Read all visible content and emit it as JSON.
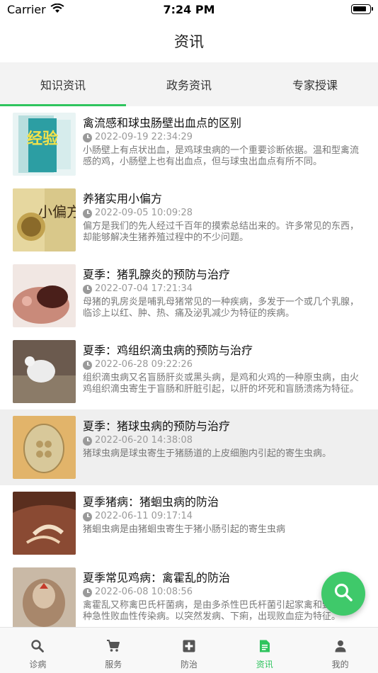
{
  "status_bar": {
    "carrier": "Carrier",
    "time": "7:24 PM"
  },
  "header": {
    "title": "资讯"
  },
  "tabs": [
    {
      "label": "知识资讯",
      "active": true
    },
    {
      "label": "政务资讯",
      "active": false
    },
    {
      "label": "专家授课",
      "active": false
    }
  ],
  "articles": [
    {
      "title": "禽流感和球虫肠壁出血点的区别",
      "date": "2022-09-19 22:34:29",
      "summary": "小肠壁上有点状出血，是鸡球虫病的一个重要诊断依据。温和型禽流感的鸡，小肠壁上也有出血点，但与球虫出血点有所不同。",
      "thumb_text": "经验"
    },
    {
      "title": "养猪实用小偏方",
      "date": "2022-09-05 10:09:28",
      "summary": "偏方是我们的先人经过千百年的摸索总结出来的。许多常见的东西，却能够解决生猪养殖过程中的不少问题。",
      "thumb_text": "小偏方"
    },
    {
      "title": "夏季：猪乳腺炎的预防与治疗",
      "date": "2022-07-04 17:21:34",
      "summary": "母猪的乳房炎是哺乳母猪常见的一种疾病，多发于一个或几个乳腺，临诊上以红、肿、热、痛及泌乳减少为特征的疾病。"
    },
    {
      "title": "夏季：鸡组织滴虫病的预防与治疗",
      "date": "2022-06-28 09:22:26",
      "summary": "组织滴虫病又名盲肠肝炎或黑头病，是鸡和火鸡的一种原虫病，由火鸡组织滴虫寄生于盲肠和肝脏引起，以肝的坏死和盲肠溃疡为特征。"
    },
    {
      "title": "夏季：猪球虫病的预防与治疗",
      "date": "2022-06-20 14:38:08",
      "summary": "猪球虫病是球虫寄生于猪肠道的上皮细胞内引起的寄生虫病。"
    },
    {
      "title": "夏季猪病：猪蛔虫病的防治",
      "date": "2022-06-11 09:17:14",
      "summary": "猪蛔虫病是由猪蛔虫寄生于猪小肠引起的寄生虫病"
    },
    {
      "title": "夏季常见鸡病：禽霍乱的防治",
      "date": "2022-06-08 10:08:56",
      "summary": "禽霍乱又称禽巴氏杆菌病，是由多杀性巴氏杆菌引起家禽和野禽的一种急性败血性传染病。以突然发病、下痢，出现败血症为特征。"
    }
  ],
  "bottom_tabs": [
    {
      "label": "诊病",
      "icon": "search-icon",
      "active": false
    },
    {
      "label": "服务",
      "icon": "cart-icon",
      "active": false
    },
    {
      "label": "防治",
      "icon": "medical-plus-icon",
      "active": false
    },
    {
      "label": "资讯",
      "icon": "news-icon",
      "active": true
    },
    {
      "label": "我的",
      "icon": "person-icon",
      "active": false
    }
  ],
  "fab": {
    "icon": "search-icon"
  },
  "colors": {
    "accent": "#2fc45e",
    "fab": "#3fc96a",
    "selected_row": "#efefef"
  }
}
